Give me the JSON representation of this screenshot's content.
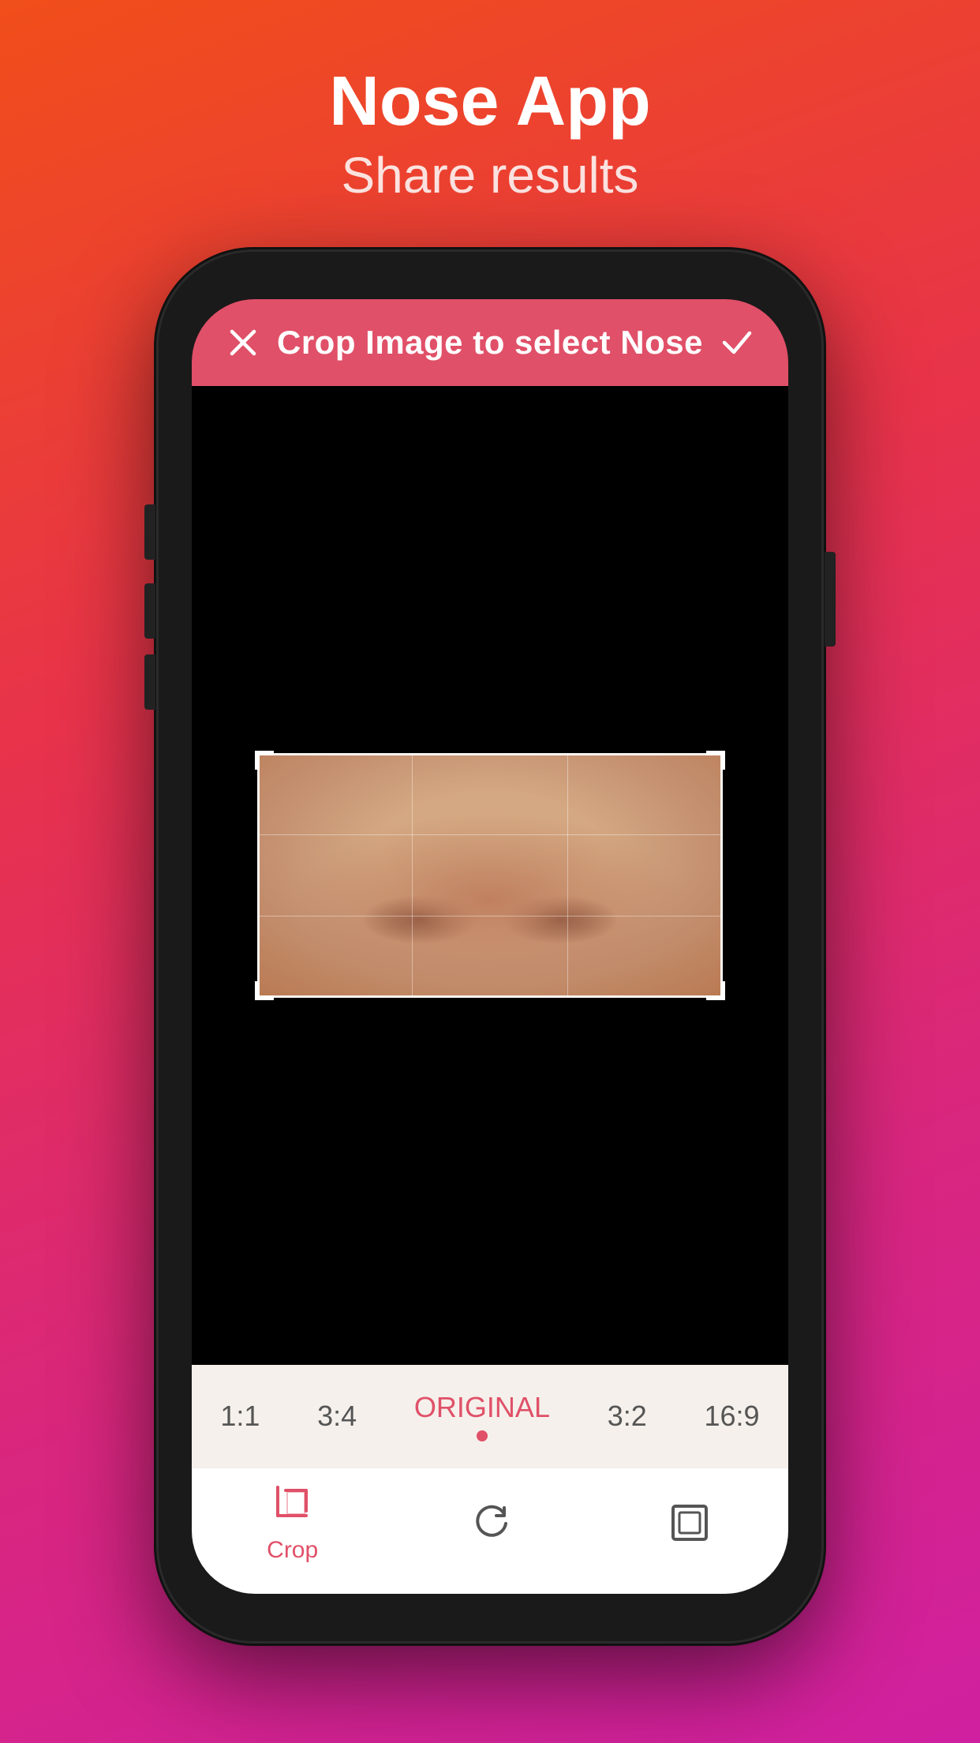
{
  "app": {
    "title": "Nose App",
    "subtitle": "Share results"
  },
  "crop_screen": {
    "header_title": "Crop Image to select Nose",
    "close_icon": "✕",
    "check_icon": "✓"
  },
  "ratio_bar": {
    "items": [
      {
        "label": "1:1",
        "active": false
      },
      {
        "label": "3:4",
        "active": false
      },
      {
        "label": "ORIGINAL",
        "active": true
      },
      {
        "label": "3:2",
        "active": false
      },
      {
        "label": "16:9",
        "active": false
      }
    ]
  },
  "toolbar": {
    "items": [
      {
        "name": "Crop",
        "icon": "crop"
      },
      {
        "name": "",
        "icon": "rotate"
      },
      {
        "name": "",
        "icon": "expand"
      }
    ],
    "crop_label": "Crop"
  },
  "colors": {
    "header_bg": "#e05068",
    "accent": "#e05068",
    "background_gradient_start": "#f04e1a",
    "background_gradient_end": "#d020a0"
  }
}
